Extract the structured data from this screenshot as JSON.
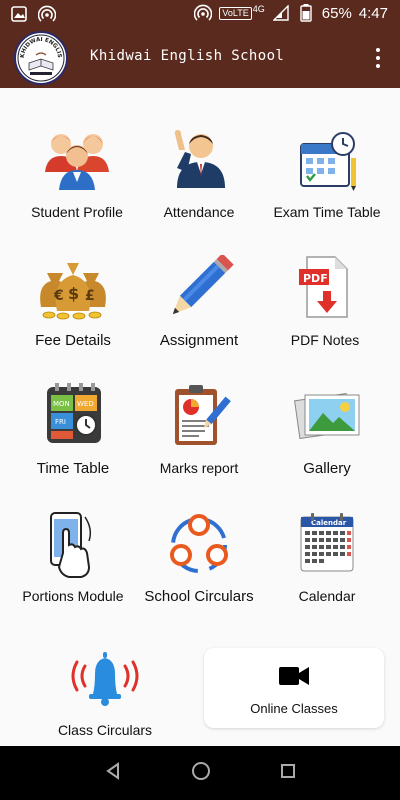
{
  "status_bar": {
    "battery": "65%",
    "time": "4:47",
    "volte": "VoLTE",
    "network": "4G"
  },
  "app_bar": {
    "title": "Khidwai English School",
    "logo_text": "KHIDWAI ENGLISH SCHOOL"
  },
  "menu": [
    {
      "label": "Student Profile",
      "icon": "students-icon"
    },
    {
      "label": "Attendance",
      "icon": "person-raising-hand-icon"
    },
    {
      "label": "Exam Time Table",
      "icon": "calendar-clock-icon"
    },
    {
      "label": "Fee Details",
      "icon": "money-bags-icon"
    },
    {
      "label": "Assignment",
      "icon": "pencil-icon"
    },
    {
      "label": "PDF Notes",
      "icon": "pdf-download-icon"
    },
    {
      "label": "Time Table",
      "icon": "timetable-icon"
    },
    {
      "label": "Marks report",
      "icon": "clipboard-report-icon"
    },
    {
      "label": "Gallery",
      "icon": "gallery-icon"
    },
    {
      "label": "Portions Module",
      "icon": "touch-phone-icon"
    },
    {
      "label": "School Circulars",
      "icon": "network-circles-icon"
    },
    {
      "label": "Calendar",
      "icon": "calendar-icon"
    },
    {
      "label": "Class Circulars",
      "icon": "ringing-bell-icon"
    }
  ],
  "online_classes": {
    "label": "Online Classes",
    "icon": "video-camera-icon"
  },
  "calendar_icon_text": "Calendar",
  "pdf_icon_text": "PDF",
  "timetable_icon_text": [
    "MON",
    "WED",
    "FRI"
  ]
}
